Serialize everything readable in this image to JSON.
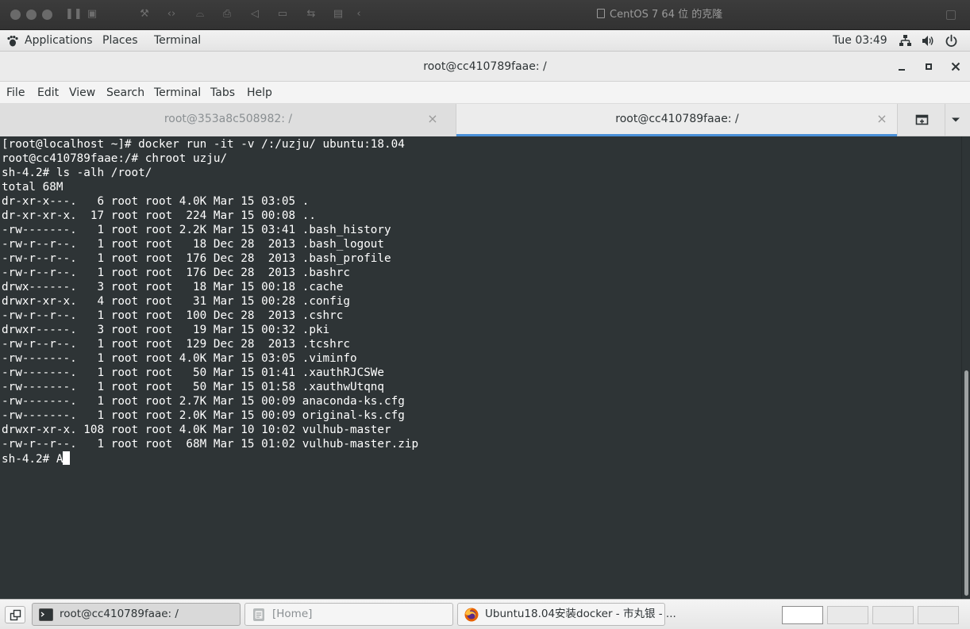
{
  "vm": {
    "title": "CentOS 7 64 位 的克隆"
  },
  "panel": {
    "applications": "Applications",
    "places": "Places",
    "terminal": "Terminal",
    "clock": "Tue 03:49"
  },
  "window": {
    "title": "root@cc410789faae: /"
  },
  "menu": {
    "file": "File",
    "edit": "Edit",
    "view": "View",
    "search": "Search",
    "terminal": "Terminal",
    "tabs": "Tabs",
    "help": "Help"
  },
  "tabs": [
    {
      "label": "root@353a8c508982: /",
      "active": false
    },
    {
      "label": "root@cc410789faae: /",
      "active": true
    }
  ],
  "terminal": {
    "lines": [
      "[root@localhost ~]# docker run -it -v /:/uzju/ ubuntu:18.04",
      "root@cc410789faae:/# chroot uzju/",
      "sh-4.2# ls -alh /root/",
      "total 68M",
      "dr-xr-x---.   6 root root 4.0K Mar 15 03:05 .",
      "dr-xr-xr-x.  17 root root  224 Mar 15 00:08 ..",
      "-rw-------.   1 root root 2.2K Mar 15 03:41 .bash_history",
      "-rw-r--r--.   1 root root   18 Dec 28  2013 .bash_logout",
      "-rw-r--r--.   1 root root  176 Dec 28  2013 .bash_profile",
      "-rw-r--r--.   1 root root  176 Dec 28  2013 .bashrc",
      "drwx------.   3 root root   18 Mar 15 00:18 .cache",
      "drwxr-xr-x.   4 root root   31 Mar 15 00:28 .config",
      "-rw-r--r--.   1 root root  100 Dec 28  2013 .cshrc",
      "drwxr-----.   3 root root   19 Mar 15 00:32 .pki",
      "-rw-r--r--.   1 root root  129 Dec 28  2013 .tcshrc",
      "-rw-------.   1 root root 4.0K Mar 15 03:05 .viminfo",
      "-rw-------.   1 root root   50 Mar 15 01:41 .xauthRJCSWe",
      "-rw-------.   1 root root   50 Mar 15 01:58 .xauthwUtqnq",
      "-rw-------.   1 root root 2.7K Mar 15 00:09 anaconda-ks.cfg",
      "-rw-------.   1 root root 2.0K Mar 15 00:09 original-ks.cfg",
      "drwxr-xr-x. 108 root root 4.0K Mar 10 10:02 vulhub-master",
      "-rw-r--r--.   1 root root  68M Mar 15 01:02 vulhub-master.zip"
    ],
    "prompt": "sh-4.2# ",
    "input": "A"
  },
  "taskbar": {
    "tasks": [
      {
        "label": "root@cc410789faae: /",
        "icon": "terminal-icon"
      },
      {
        "label": "[Home]",
        "icon": "folder-icon"
      },
      {
        "label": "Ubuntu18.04安装docker - 市丸银 - ...",
        "icon": "firefox-icon"
      }
    ]
  },
  "colors": {
    "terminal_bg": "#2e3436",
    "terminal_fg": "#ffffff",
    "tab_accent": "#4a90d9"
  }
}
